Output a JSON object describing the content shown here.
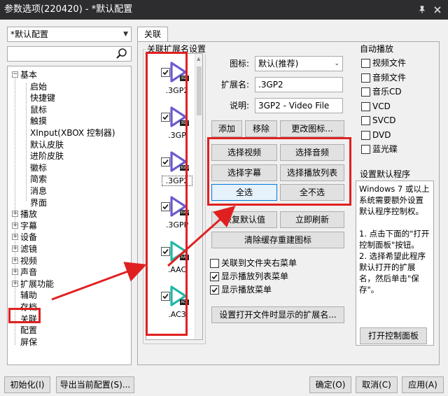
{
  "window": {
    "title": "参数选项(220420) - *默认配置",
    "pin_icon": "pin-icon",
    "close_icon": "close-icon"
  },
  "profile_select": {
    "value": "*默认配置"
  },
  "search": {
    "value": "",
    "icon": "search-icon"
  },
  "tree": {
    "items": [
      {
        "label": "基本",
        "level": 0,
        "expander": "−"
      },
      {
        "label": "启始",
        "level": 1
      },
      {
        "label": "快捷键",
        "level": 1
      },
      {
        "label": "鼠标",
        "level": 1
      },
      {
        "label": "触摸",
        "level": 1
      },
      {
        "label": "XInput(XBOX 控制器)",
        "level": 1
      },
      {
        "label": "默认皮肤",
        "level": 1
      },
      {
        "label": "进阶皮肤",
        "level": 1
      },
      {
        "label": "徽标",
        "level": 1
      },
      {
        "label": "简索",
        "level": 1
      },
      {
        "label": "消息",
        "level": 1
      },
      {
        "label": "界面",
        "level": 1
      },
      {
        "label": "播放",
        "level": 0,
        "expander": "+"
      },
      {
        "label": "字幕",
        "level": 0,
        "expander": "+"
      },
      {
        "label": "设备",
        "level": 0,
        "expander": "+"
      },
      {
        "label": "滤镜",
        "level": 0,
        "expander": "+"
      },
      {
        "label": "视频",
        "level": 0,
        "expander": "+"
      },
      {
        "label": "声音",
        "level": 0,
        "expander": "+"
      },
      {
        "label": "扩展功能",
        "level": 0,
        "expander": "+"
      },
      {
        "label": "辅助",
        "level": 0
      },
      {
        "label": "存档",
        "level": 0
      },
      {
        "label": "关联",
        "level": 0
      },
      {
        "label": "配置",
        "level": 0
      },
      {
        "label": "屏保",
        "level": 0
      }
    ]
  },
  "tab": {
    "label": "关联"
  },
  "ext_group": {
    "label": "关联扩展名设置",
    "items": [
      {
        "ext": ".3GP2",
        "badge": "3G2",
        "checked": true,
        "color": "#6a5acd"
      },
      {
        "ext": ".3GP",
        "badge": "3GP",
        "checked": true,
        "color": "#6a5acd"
      },
      {
        "ext": ".3GP2",
        "badge": "3GP2",
        "checked": true,
        "color": "#6a5acd",
        "selected": true
      },
      {
        "ext": ".3GPP",
        "badge": "3GPP",
        "checked": true,
        "color": "#6a5acd"
      },
      {
        "ext": ".AAC",
        "badge": "AAC",
        "checked": true,
        "color": "#1fb8a8"
      },
      {
        "ext": ".AC3",
        "badge": "AC3",
        "checked": true,
        "color": "#1fb8a8"
      }
    ]
  },
  "details": {
    "icon_label": "图标:",
    "icon_value": "默认(推荐)",
    "ext_label": "扩展名:",
    "ext_value": ".3GP2",
    "desc_label": "说明:",
    "desc_value": "3GP2 - Video File"
  },
  "buttons": {
    "add": "添加",
    "remove": "移除",
    "change_icon": "更改图标...",
    "select_video": "选择视频",
    "select_audio": "选择音频",
    "select_subtitle": "选择字幕",
    "select_playlist": "选择播放列表",
    "select_all": "全选",
    "select_none": "全不选",
    "restore_default": "恢复默认值",
    "refresh_now": "立即刷新",
    "clear_cache": "清除缓存重建图标",
    "set_shown_exts": "设置打开文件时显示的扩展名...",
    "open_control_panel": "打开控制面板",
    "init": "初始化(I)",
    "export": "导出当前配置(S)...",
    "ok": "确定(O)",
    "cancel": "取消(C)",
    "apply": "应用(A)"
  },
  "options": [
    {
      "label": "关联到文件夹右菜单",
      "checked": false
    },
    {
      "label": "显示播放列表菜单",
      "checked": true
    },
    {
      "label": "显示播放菜单",
      "checked": true
    }
  ],
  "autoplay": {
    "label": "自动播放",
    "items": [
      {
        "label": "视频文件",
        "checked": false
      },
      {
        "label": "音频文件",
        "checked": false
      },
      {
        "label": "音乐CD",
        "checked": false
      },
      {
        "label": "VCD",
        "checked": false
      },
      {
        "label": "SVCD",
        "checked": false
      },
      {
        "label": "DVD",
        "checked": false
      },
      {
        "label": "蓝光碟",
        "checked": false
      }
    ]
  },
  "default_program": {
    "label": "设置默认程序",
    "lines": [
      "Windows 7 或以上",
      "系统需要额外设置",
      "默认程序控制权。",
      "",
      "1. 点击下面的\"打开",
      "控制面板\"按钮。",
      "2. 选择希望此程序",
      "默认打开的扩展",
      "名，然后单击\"保",
      "存\"。"
    ]
  },
  "colors": {
    "highlight_red": "#e02020",
    "titlebar_bg": "#2d2d30"
  }
}
